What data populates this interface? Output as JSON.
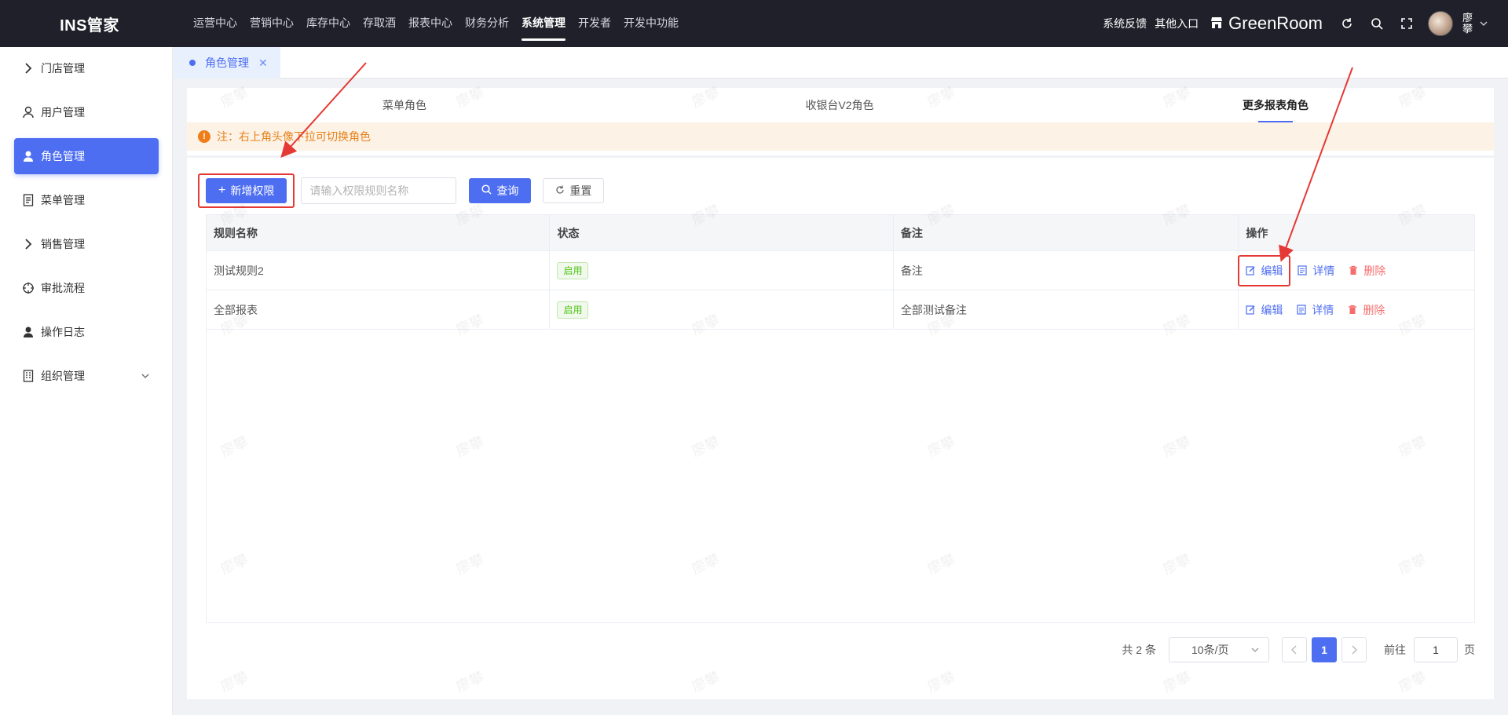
{
  "app": {
    "logo": "INS管家"
  },
  "topnav": {
    "items": [
      {
        "label": "运营中心"
      },
      {
        "label": "营销中心"
      },
      {
        "label": "库存中心"
      },
      {
        "label": "存取酒"
      },
      {
        "label": "报表中心"
      },
      {
        "label": "财务分析"
      },
      {
        "label": "系统管理",
        "active": true
      },
      {
        "label": "开发者"
      },
      {
        "label": "开发中功能"
      }
    ],
    "feedback": "系统反馈",
    "other_entry": "其他入口",
    "store_name": "GreenRoom",
    "username": "廖攀"
  },
  "sidebar": {
    "items": [
      {
        "label": "门店管理",
        "icon": "chevron-right-icon"
      },
      {
        "label": "用户管理",
        "icon": "user-outline-icon"
      },
      {
        "label": "角色管理",
        "icon": "user-icon",
        "active": true
      },
      {
        "label": "菜单管理",
        "icon": "document-icon"
      },
      {
        "label": "销售管理",
        "icon": "chevron-right-icon"
      },
      {
        "label": "审批流程",
        "icon": "crosshair-icon"
      },
      {
        "label": "操作日志",
        "icon": "user-icon"
      },
      {
        "label": "组织管理",
        "icon": "building-icon"
      }
    ]
  },
  "page_tab": {
    "label": "角色管理"
  },
  "role_tabs": [
    {
      "label": "菜单角色"
    },
    {
      "label": "收银台V2角色"
    },
    {
      "label": "更多报表角色",
      "active": true
    }
  ],
  "notice": {
    "text": "注：右上角头像下拉可切换角色"
  },
  "toolbar": {
    "add_label": "新增权限",
    "search_placeholder": "请输入权限规则名称",
    "query_label": "查询",
    "reset_label": "重置"
  },
  "table": {
    "headers": [
      "规则名称",
      "状态",
      "备注",
      "操作"
    ],
    "rows": [
      {
        "name": "测试规则2",
        "status": "启用",
        "remark": "备注"
      },
      {
        "name": "全部报表",
        "status": "启用",
        "remark": "全部测试备注"
      }
    ],
    "actions": {
      "edit": "编辑",
      "detail": "详情",
      "delete": "删除"
    }
  },
  "pagination": {
    "total": "共 2 条",
    "page_size": "10条/页",
    "current_page": "1",
    "goto_prefix": "前往",
    "goto_value": "1",
    "goto_suffix": "页"
  },
  "watermark": "廖攀",
  "colors": {
    "primary": "#4e6ef2",
    "topbar": "#1f2029",
    "notice_bg": "#fdf2e6",
    "notice_text": "#e6811a",
    "danger": "#f56c6c",
    "annotation": "#e53935"
  }
}
